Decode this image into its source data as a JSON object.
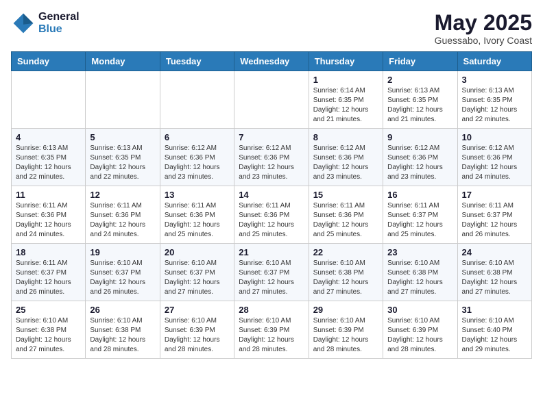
{
  "logo": {
    "line1": "General",
    "line2": "Blue"
  },
  "title": "May 2025",
  "subtitle": "Guessabo, Ivory Coast",
  "days_header": [
    "Sunday",
    "Monday",
    "Tuesday",
    "Wednesday",
    "Thursday",
    "Friday",
    "Saturday"
  ],
  "weeks": [
    [
      {
        "day": "",
        "info": ""
      },
      {
        "day": "",
        "info": ""
      },
      {
        "day": "",
        "info": ""
      },
      {
        "day": "",
        "info": ""
      },
      {
        "day": "1",
        "info": "Sunrise: 6:14 AM\nSunset: 6:35 PM\nDaylight: 12 hours\nand 21 minutes."
      },
      {
        "day": "2",
        "info": "Sunrise: 6:13 AM\nSunset: 6:35 PM\nDaylight: 12 hours\nand 21 minutes."
      },
      {
        "day": "3",
        "info": "Sunrise: 6:13 AM\nSunset: 6:35 PM\nDaylight: 12 hours\nand 22 minutes."
      }
    ],
    [
      {
        "day": "4",
        "info": "Sunrise: 6:13 AM\nSunset: 6:35 PM\nDaylight: 12 hours\nand 22 minutes."
      },
      {
        "day": "5",
        "info": "Sunrise: 6:13 AM\nSunset: 6:35 PM\nDaylight: 12 hours\nand 22 minutes."
      },
      {
        "day": "6",
        "info": "Sunrise: 6:12 AM\nSunset: 6:36 PM\nDaylight: 12 hours\nand 23 minutes."
      },
      {
        "day": "7",
        "info": "Sunrise: 6:12 AM\nSunset: 6:36 PM\nDaylight: 12 hours\nand 23 minutes."
      },
      {
        "day": "8",
        "info": "Sunrise: 6:12 AM\nSunset: 6:36 PM\nDaylight: 12 hours\nand 23 minutes."
      },
      {
        "day": "9",
        "info": "Sunrise: 6:12 AM\nSunset: 6:36 PM\nDaylight: 12 hours\nand 23 minutes."
      },
      {
        "day": "10",
        "info": "Sunrise: 6:12 AM\nSunset: 6:36 PM\nDaylight: 12 hours\nand 24 minutes."
      }
    ],
    [
      {
        "day": "11",
        "info": "Sunrise: 6:11 AM\nSunset: 6:36 PM\nDaylight: 12 hours\nand 24 minutes."
      },
      {
        "day": "12",
        "info": "Sunrise: 6:11 AM\nSunset: 6:36 PM\nDaylight: 12 hours\nand 24 minutes."
      },
      {
        "day": "13",
        "info": "Sunrise: 6:11 AM\nSunset: 6:36 PM\nDaylight: 12 hours\nand 25 minutes."
      },
      {
        "day": "14",
        "info": "Sunrise: 6:11 AM\nSunset: 6:36 PM\nDaylight: 12 hours\nand 25 minutes."
      },
      {
        "day": "15",
        "info": "Sunrise: 6:11 AM\nSunset: 6:36 PM\nDaylight: 12 hours\nand 25 minutes."
      },
      {
        "day": "16",
        "info": "Sunrise: 6:11 AM\nSunset: 6:37 PM\nDaylight: 12 hours\nand 25 minutes."
      },
      {
        "day": "17",
        "info": "Sunrise: 6:11 AM\nSunset: 6:37 PM\nDaylight: 12 hours\nand 26 minutes."
      }
    ],
    [
      {
        "day": "18",
        "info": "Sunrise: 6:11 AM\nSunset: 6:37 PM\nDaylight: 12 hours\nand 26 minutes."
      },
      {
        "day": "19",
        "info": "Sunrise: 6:10 AM\nSunset: 6:37 PM\nDaylight: 12 hours\nand 26 minutes."
      },
      {
        "day": "20",
        "info": "Sunrise: 6:10 AM\nSunset: 6:37 PM\nDaylight: 12 hours\nand 27 minutes."
      },
      {
        "day": "21",
        "info": "Sunrise: 6:10 AM\nSunset: 6:37 PM\nDaylight: 12 hours\nand 27 minutes."
      },
      {
        "day": "22",
        "info": "Sunrise: 6:10 AM\nSunset: 6:38 PM\nDaylight: 12 hours\nand 27 minutes."
      },
      {
        "day": "23",
        "info": "Sunrise: 6:10 AM\nSunset: 6:38 PM\nDaylight: 12 hours\nand 27 minutes."
      },
      {
        "day": "24",
        "info": "Sunrise: 6:10 AM\nSunset: 6:38 PM\nDaylight: 12 hours\nand 27 minutes."
      }
    ],
    [
      {
        "day": "25",
        "info": "Sunrise: 6:10 AM\nSunset: 6:38 PM\nDaylight: 12 hours\nand 27 minutes."
      },
      {
        "day": "26",
        "info": "Sunrise: 6:10 AM\nSunset: 6:38 PM\nDaylight: 12 hours\nand 28 minutes."
      },
      {
        "day": "27",
        "info": "Sunrise: 6:10 AM\nSunset: 6:39 PM\nDaylight: 12 hours\nand 28 minutes."
      },
      {
        "day": "28",
        "info": "Sunrise: 6:10 AM\nSunset: 6:39 PM\nDaylight: 12 hours\nand 28 minutes."
      },
      {
        "day": "29",
        "info": "Sunrise: 6:10 AM\nSunset: 6:39 PM\nDaylight: 12 hours\nand 28 minutes."
      },
      {
        "day": "30",
        "info": "Sunrise: 6:10 AM\nSunset: 6:39 PM\nDaylight: 12 hours\nand 28 minutes."
      },
      {
        "day": "31",
        "info": "Sunrise: 6:10 AM\nSunset: 6:40 PM\nDaylight: 12 hours\nand 29 minutes."
      }
    ]
  ]
}
